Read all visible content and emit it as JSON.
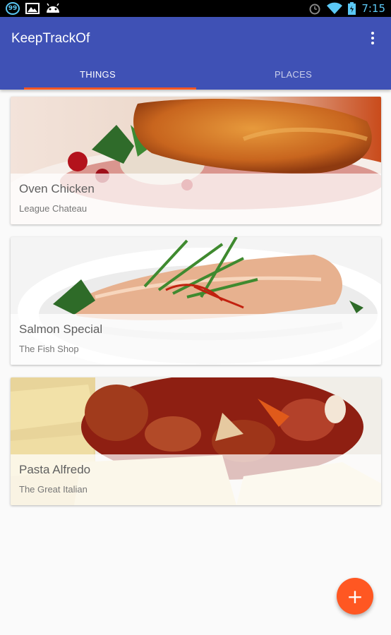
{
  "status_bar": {
    "notification_badge": "99",
    "time": "7:15",
    "icons": [
      "notification-badge-icon",
      "image-icon",
      "android-icon",
      "alarm-icon",
      "wifi-icon",
      "battery-icon"
    ]
  },
  "app_bar": {
    "title": "KeepTrackOf",
    "color": "#3f51b5",
    "tabs": [
      {
        "label": "THINGS",
        "active": true
      },
      {
        "label": "PLACES",
        "active": false
      }
    ],
    "indicator_color": "#ff5722"
  },
  "items": [
    {
      "name": "Oven Chicken",
      "place": "League Chateau"
    },
    {
      "name": "Salmon Special",
      "place": "The Fish Shop"
    },
    {
      "name": "Pasta Alfredo",
      "place": "The Great Italian"
    }
  ],
  "fab": {
    "label": "+",
    "color": "#ff5722"
  }
}
